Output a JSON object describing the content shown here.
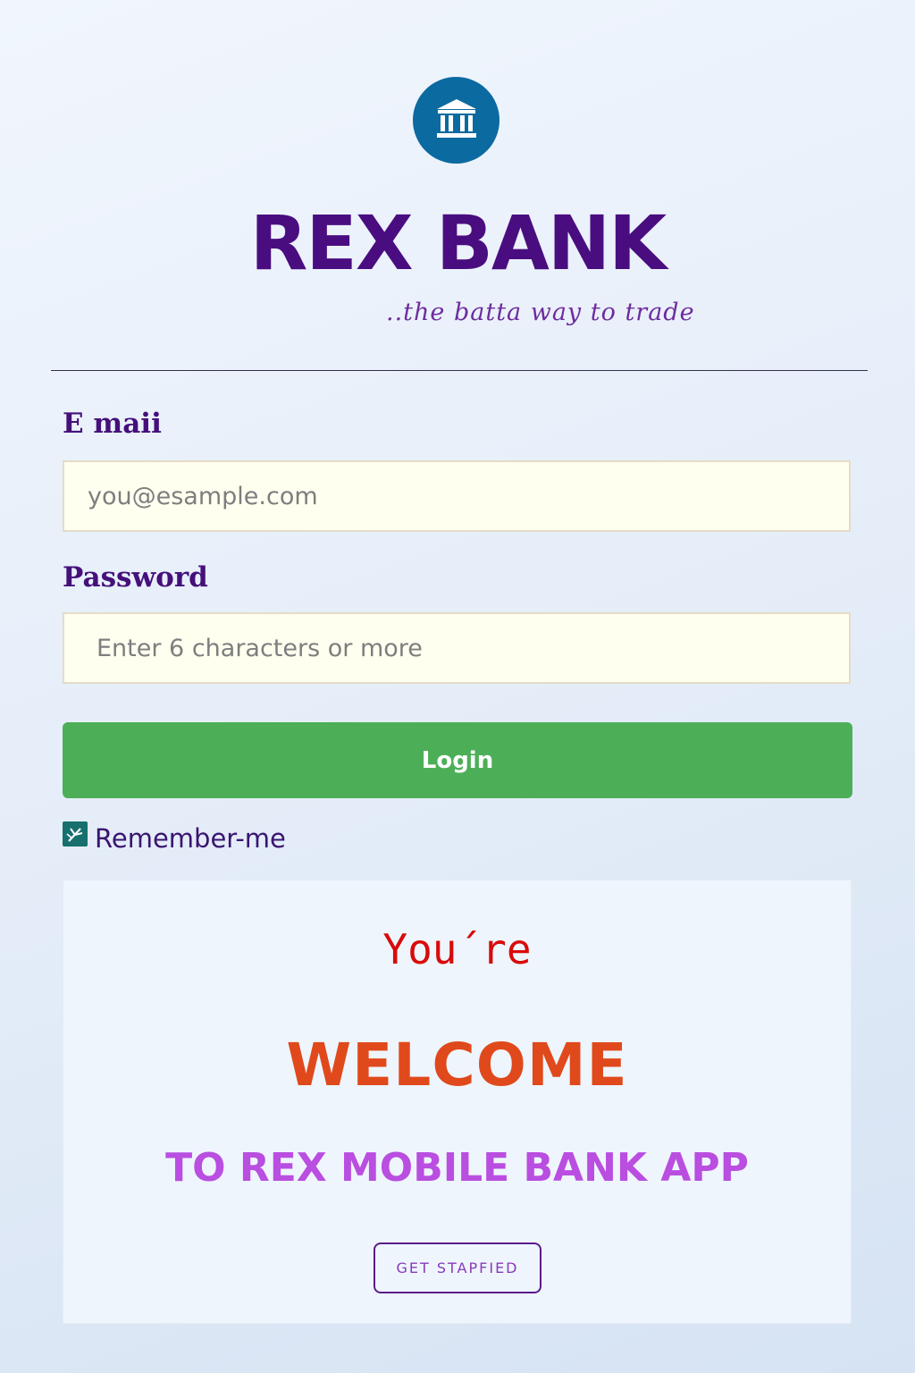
{
  "brand": {
    "name": "REX BANK",
    "tagline": "..the batta way to trade",
    "logo_icon": "bank-building-icon",
    "logo_color": "#0b6aa0",
    "text_color": "#4a0d80"
  },
  "form": {
    "email": {
      "label": "E maii",
      "placeholder": "you@esample.com"
    },
    "password": {
      "label": "Password",
      "placeholder": "Enter 6 characters or more"
    },
    "login_button_label": "Login",
    "login_button_color": "#4caf58",
    "remember": {
      "label": "Remember-me",
      "icon": "checkbox-icon"
    }
  },
  "welcome": {
    "pre": "You´re",
    "main": "WELCOME",
    "sub": "TO REX MOBILE BANK APP",
    "button_label": "GET STAPFIED",
    "colors": {
      "pre": "#d90a0a",
      "main": "#e0491b",
      "sub": "#b94ee0"
    }
  }
}
